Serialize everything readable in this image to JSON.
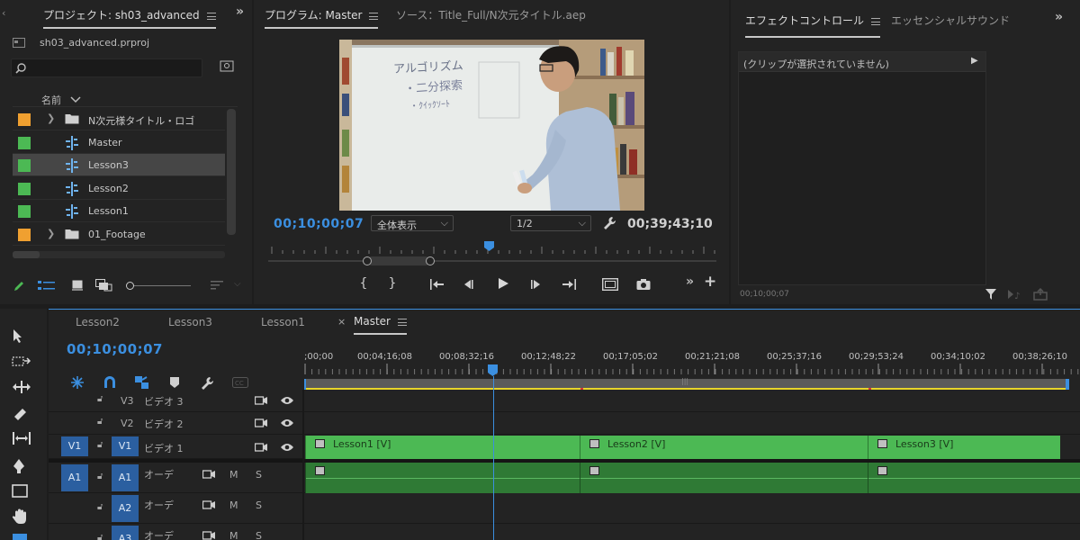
{
  "project": {
    "tab_label": "プロジェクト: sh03_advanced",
    "file_name": "sh03_advanced.prproj",
    "column_header": "名前",
    "items": [
      {
        "name": "N次元様タイトル・ロゴ",
        "type": "folder",
        "color": "#f0a030"
      },
      {
        "name": "Master",
        "type": "sequence",
        "color": "#4cb954"
      },
      {
        "name": "Lesson3",
        "type": "sequence",
        "color": "#4cb954"
      },
      {
        "name": "Lesson2",
        "type": "sequence",
        "color": "#4cb954"
      },
      {
        "name": "Lesson1",
        "type": "sequence",
        "color": "#4cb954"
      },
      {
        "name": "01_Footage",
        "type": "folder",
        "color": "#f0a030"
      }
    ]
  },
  "program": {
    "tab_label": "プログラム: Master",
    "source_tab_label": "ソース：Title_Full/N次元タイトル.aep",
    "current_time": "00;10;00;07",
    "fit_label": "全体表示",
    "resolution_label": "1/2",
    "duration": "00;39;43;10"
  },
  "effects": {
    "tab_label": "エフェクトコントロール",
    "essential_tab_label": "エッセンシャルサウンド",
    "no_clip_label": "(クリップが選択されていません)",
    "time_readout": "00;10;00;07"
  },
  "timeline": {
    "tabs": [
      "Lesson2",
      "Lesson3",
      "Lesson1",
      "Master"
    ],
    "current_time": "00;10;00;07",
    "ruler_labels": [
      ";00;00",
      "00;04;16;08",
      "00;08;32;16",
      "00;12;48;22",
      "00;17;05;02",
      "00;21;21;08",
      "00;25;37;16",
      "00;29;53;24",
      "00;34;10;02",
      "00;38;26;10"
    ],
    "video_tracks": [
      {
        "name": "V3",
        "label": "ビデオ 3"
      },
      {
        "name": "V2",
        "label": "ビデオ 2"
      },
      {
        "name": "V1",
        "label": "ビデオ 1",
        "source": "V1"
      }
    ],
    "audio_tracks": [
      {
        "name": "A1",
        "label": "オーデ",
        "source": "A1"
      },
      {
        "name": "A2",
        "label": "オーデ"
      },
      {
        "name": "A3",
        "label": "オーデ"
      }
    ],
    "mute_label": "M",
    "solo_label": "S",
    "clips": [
      "Lesson1 [V]",
      "Lesson2 [V]",
      "Lesson3 [V]"
    ]
  },
  "whiteboard": {
    "title": "アルゴリズム",
    "line1": "・二分探索",
    "line2": "・ｸｲｯｸｿｰﾄ"
  },
  "colors": {
    "accent": "#3b8fe0",
    "label_green": "#4cb954",
    "label_orange": "#f0a030"
  }
}
